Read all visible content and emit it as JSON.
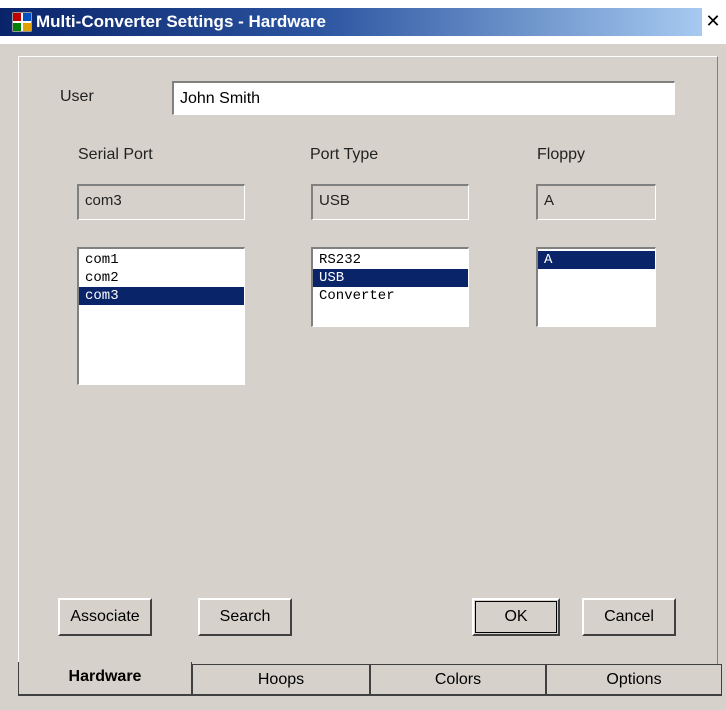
{
  "window": {
    "title": "Multi-Converter Settings - Hardware",
    "close_glyph": "✕"
  },
  "user": {
    "label": "User",
    "value": "John Smith"
  },
  "serial_port": {
    "label": "Serial Port",
    "current": "com3",
    "items": [
      "com1",
      "com2",
      "com3"
    ],
    "selected_index": 2
  },
  "port_type": {
    "label": "Port Type",
    "current": "USB",
    "items": [
      "RS232",
      "USB",
      "Converter"
    ],
    "selected_index": 1
  },
  "floppy": {
    "label": "Floppy",
    "current": "A",
    "items": [
      "A"
    ],
    "selected_index": 0
  },
  "buttons": {
    "associate": "Associate",
    "search": "Search",
    "ok": "OK",
    "cancel": "Cancel"
  },
  "tabs": [
    {
      "label": "Hardware",
      "active": true
    },
    {
      "label": "Hoops",
      "active": false
    },
    {
      "label": "Colors",
      "active": false
    },
    {
      "label": "Options",
      "active": false
    }
  ],
  "colors": {
    "selection": "#0a246a",
    "face": "#d6d2cb"
  },
  "icons": {
    "app": "app-icon",
    "close": "close-icon"
  }
}
